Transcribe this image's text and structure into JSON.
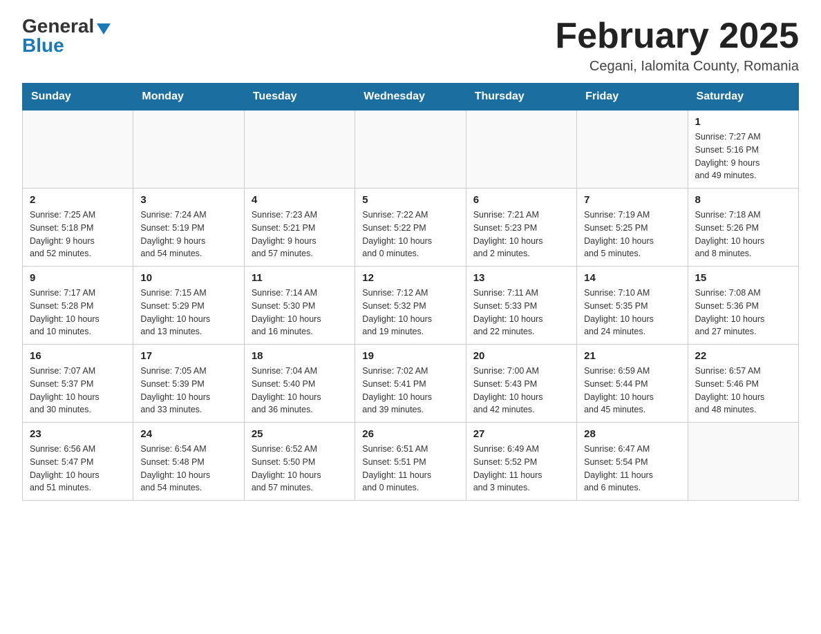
{
  "logo": {
    "general": "General",
    "blue": "Blue",
    "triangle": "▶"
  },
  "title": "February 2025",
  "subtitle": "Cegani, Ialomita County, Romania",
  "weekdays": [
    "Sunday",
    "Monday",
    "Tuesday",
    "Wednesday",
    "Thursday",
    "Friday",
    "Saturday"
  ],
  "weeks": [
    [
      {
        "day": "",
        "info": ""
      },
      {
        "day": "",
        "info": ""
      },
      {
        "day": "",
        "info": ""
      },
      {
        "day": "",
        "info": ""
      },
      {
        "day": "",
        "info": ""
      },
      {
        "day": "",
        "info": ""
      },
      {
        "day": "1",
        "info": "Sunrise: 7:27 AM\nSunset: 5:16 PM\nDaylight: 9 hours\nand 49 minutes."
      }
    ],
    [
      {
        "day": "2",
        "info": "Sunrise: 7:25 AM\nSunset: 5:18 PM\nDaylight: 9 hours\nand 52 minutes."
      },
      {
        "day": "3",
        "info": "Sunrise: 7:24 AM\nSunset: 5:19 PM\nDaylight: 9 hours\nand 54 minutes."
      },
      {
        "day": "4",
        "info": "Sunrise: 7:23 AM\nSunset: 5:21 PM\nDaylight: 9 hours\nand 57 minutes."
      },
      {
        "day": "5",
        "info": "Sunrise: 7:22 AM\nSunset: 5:22 PM\nDaylight: 10 hours\nand 0 minutes."
      },
      {
        "day": "6",
        "info": "Sunrise: 7:21 AM\nSunset: 5:23 PM\nDaylight: 10 hours\nand 2 minutes."
      },
      {
        "day": "7",
        "info": "Sunrise: 7:19 AM\nSunset: 5:25 PM\nDaylight: 10 hours\nand 5 minutes."
      },
      {
        "day": "8",
        "info": "Sunrise: 7:18 AM\nSunset: 5:26 PM\nDaylight: 10 hours\nand 8 minutes."
      }
    ],
    [
      {
        "day": "9",
        "info": "Sunrise: 7:17 AM\nSunset: 5:28 PM\nDaylight: 10 hours\nand 10 minutes."
      },
      {
        "day": "10",
        "info": "Sunrise: 7:15 AM\nSunset: 5:29 PM\nDaylight: 10 hours\nand 13 minutes."
      },
      {
        "day": "11",
        "info": "Sunrise: 7:14 AM\nSunset: 5:30 PM\nDaylight: 10 hours\nand 16 minutes."
      },
      {
        "day": "12",
        "info": "Sunrise: 7:12 AM\nSunset: 5:32 PM\nDaylight: 10 hours\nand 19 minutes."
      },
      {
        "day": "13",
        "info": "Sunrise: 7:11 AM\nSunset: 5:33 PM\nDaylight: 10 hours\nand 22 minutes."
      },
      {
        "day": "14",
        "info": "Sunrise: 7:10 AM\nSunset: 5:35 PM\nDaylight: 10 hours\nand 24 minutes."
      },
      {
        "day": "15",
        "info": "Sunrise: 7:08 AM\nSunset: 5:36 PM\nDaylight: 10 hours\nand 27 minutes."
      }
    ],
    [
      {
        "day": "16",
        "info": "Sunrise: 7:07 AM\nSunset: 5:37 PM\nDaylight: 10 hours\nand 30 minutes."
      },
      {
        "day": "17",
        "info": "Sunrise: 7:05 AM\nSunset: 5:39 PM\nDaylight: 10 hours\nand 33 minutes."
      },
      {
        "day": "18",
        "info": "Sunrise: 7:04 AM\nSunset: 5:40 PM\nDaylight: 10 hours\nand 36 minutes."
      },
      {
        "day": "19",
        "info": "Sunrise: 7:02 AM\nSunset: 5:41 PM\nDaylight: 10 hours\nand 39 minutes."
      },
      {
        "day": "20",
        "info": "Sunrise: 7:00 AM\nSunset: 5:43 PM\nDaylight: 10 hours\nand 42 minutes."
      },
      {
        "day": "21",
        "info": "Sunrise: 6:59 AM\nSunset: 5:44 PM\nDaylight: 10 hours\nand 45 minutes."
      },
      {
        "day": "22",
        "info": "Sunrise: 6:57 AM\nSunset: 5:46 PM\nDaylight: 10 hours\nand 48 minutes."
      }
    ],
    [
      {
        "day": "23",
        "info": "Sunrise: 6:56 AM\nSunset: 5:47 PM\nDaylight: 10 hours\nand 51 minutes."
      },
      {
        "day": "24",
        "info": "Sunrise: 6:54 AM\nSunset: 5:48 PM\nDaylight: 10 hours\nand 54 minutes."
      },
      {
        "day": "25",
        "info": "Sunrise: 6:52 AM\nSunset: 5:50 PM\nDaylight: 10 hours\nand 57 minutes."
      },
      {
        "day": "26",
        "info": "Sunrise: 6:51 AM\nSunset: 5:51 PM\nDaylight: 11 hours\nand 0 minutes."
      },
      {
        "day": "27",
        "info": "Sunrise: 6:49 AM\nSunset: 5:52 PM\nDaylight: 11 hours\nand 3 minutes."
      },
      {
        "day": "28",
        "info": "Sunrise: 6:47 AM\nSunset: 5:54 PM\nDaylight: 11 hours\nand 6 minutes."
      },
      {
        "day": "",
        "info": ""
      }
    ]
  ]
}
